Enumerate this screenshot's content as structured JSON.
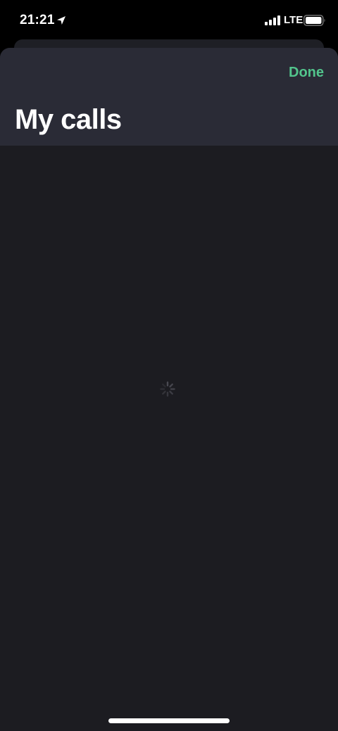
{
  "status_bar": {
    "time": "21:21",
    "network": "LTE",
    "icons": [
      "location-arrow-icon",
      "cellular-signal-icon",
      "battery-icon"
    ]
  },
  "header": {
    "title": "My calls",
    "done_label": "Done"
  },
  "content": {
    "state": "loading",
    "indicator": "spinner-icon"
  },
  "colors": {
    "accent": "#52c48c",
    "header_background": "#2a2b36",
    "content_background": "#1c1c21",
    "status_bar_background": "#000000"
  }
}
